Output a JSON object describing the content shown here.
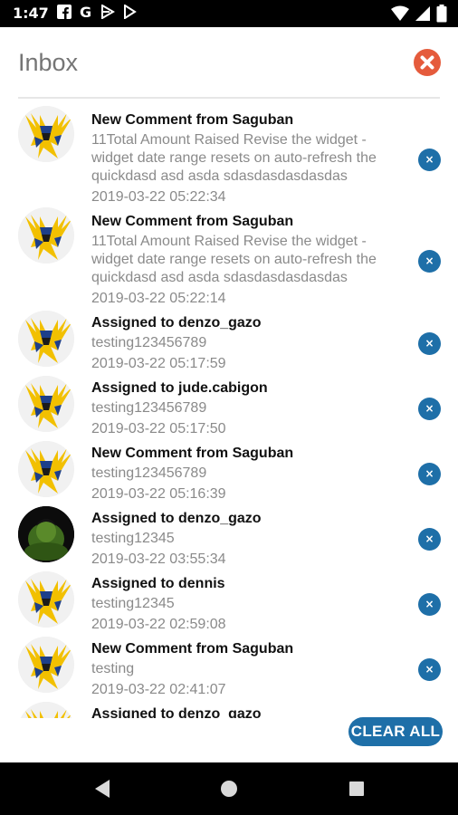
{
  "status_bar": {
    "time": "1:47",
    "left_icons": [
      "facebook-icon",
      "google-icon",
      "flag-icon",
      "play-store-icon"
    ],
    "right_icons": [
      "wifi-icon",
      "signal-icon",
      "battery-icon"
    ]
  },
  "header": {
    "title": "Inbox"
  },
  "colors": {
    "accent": "#1e6fa8",
    "close": "#e55b3c",
    "muted": "#8a8a8a"
  },
  "notifications": [
    {
      "avatar": "wolverine-avatar",
      "title": "New Comment from Saguban",
      "body": "11Total Amount Raised Revise the widget - widget date range resets on auto-refresh the quickdasd asd asda sdasdasdasdasdas",
      "time": "2019-03-22 05:22:34"
    },
    {
      "avatar": "wolverine-avatar",
      "title": "New Comment from Saguban",
      "body": "11Total Amount Raised Revise the widget - widget date range resets on auto-refresh the quickdasd asd asda sdasdasdasdasdas",
      "time": "2019-03-22 05:22:14"
    },
    {
      "avatar": "wolverine-avatar",
      "title": "Assigned to denzo_gazo",
      "body": "testing123456789",
      "time": "2019-03-22 05:17:59"
    },
    {
      "avatar": "wolverine-avatar",
      "title": "Assigned to jude.cabigon",
      "body": "testing123456789",
      "time": "2019-03-22 05:17:50"
    },
    {
      "avatar": "wolverine-avatar",
      "title": "New Comment from Saguban",
      "body": "testing123456789",
      "time": "2019-03-22 05:16:39"
    },
    {
      "avatar": "hulk-avatar",
      "title": "Assigned to denzo_gazo",
      "body": "testing12345",
      "time": "2019-03-22 03:55:34"
    },
    {
      "avatar": "wolverine-avatar",
      "title": "Assigned to dennis",
      "body": "testing12345",
      "time": "2019-03-22 02:59:08"
    },
    {
      "avatar": "wolverine-avatar",
      "title": "New Comment from Saguban",
      "body": "testing",
      "time": "2019-03-22 02:41:07"
    },
    {
      "avatar": "wolverine-avatar",
      "title": "Assigned to denzo_gazo",
      "body": "",
      "time": ""
    }
  ],
  "dismiss_glyph": "×",
  "footer": {
    "clear_all_label": "CLEAR ALL"
  }
}
